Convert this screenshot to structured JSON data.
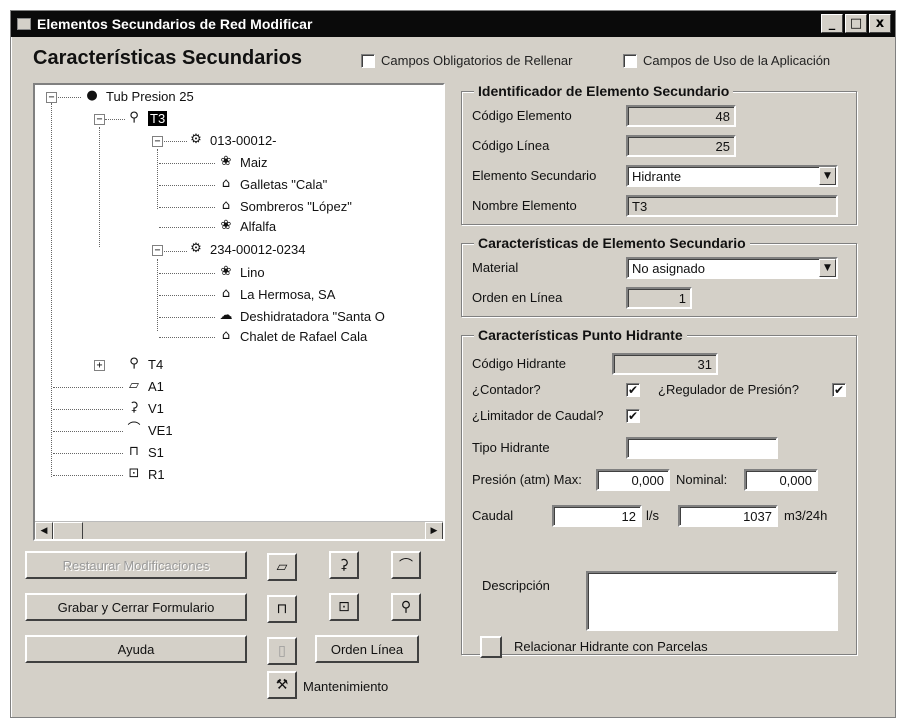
{
  "window": {
    "title": "Elementos Secundarios de Red Modificar",
    "controls": [
      "_",
      "□",
      "x"
    ]
  },
  "header": {
    "title": "Características Secundarios",
    "chk_required": "Campos Obligatorios de Rellenar",
    "chk_app": "Campos de Uso de la Aplicación"
  },
  "tree": {
    "root": "Tub Presion 25",
    "t3": "T3",
    "n1": "013-00012-",
    "n1_children": [
      "Maiz",
      "Galletas \"Cala\"",
      "Sombreros \"López\"",
      "Alfalfa"
    ],
    "n2": "234-00012-0234",
    "n2_children": [
      "Lino",
      "La Hermosa, SA",
      "Deshidratadora \"Santa O",
      "Chalet de Rafael Cala"
    ],
    "others": [
      "T4",
      "A1",
      "V1",
      "VE1",
      "S1",
      "R1"
    ]
  },
  "buttons": {
    "restore": "Restaurar Modificaciones",
    "save_close": "Grabar y Cerrar Formulario",
    "help": "Ayuda",
    "order": "Orden Línea",
    "maintenance": "Mantenimiento"
  },
  "ident": {
    "title": "Identificador de Elemento Secundario",
    "codigo_elemento_label": "Código Elemento",
    "codigo_elemento": "48",
    "codigo_linea_label": "Código Línea",
    "codigo_linea": "25",
    "elemento_label": "Elemento Secundario",
    "elemento": "Hidrante",
    "nombre_label": "Nombre Elemento",
    "nombre": "T3"
  },
  "caract": {
    "title": "Características de Elemento Secundario",
    "material_label": "Material",
    "material": "No asignado",
    "orden_label": "Orden en Línea",
    "orden": "1"
  },
  "hidrante": {
    "title": "Características Punto Hidrante",
    "codigo_label": "Código Hidrante",
    "codigo": "31",
    "contador_label": "¿Contador?",
    "contador": "✔",
    "regulador_label": "¿Regulador de Presión?",
    "regulador": "✔",
    "limitador_label": "¿Limitador de Caudal?",
    "limitador": "✔",
    "tipo_label": "Tipo Hidrante",
    "tipo": "",
    "presion_label": "Presión (atm) Max:",
    "presion_max": "0,000",
    "nominal_label": "Nominal:",
    "presion_nominal": "0,000",
    "caudal_label": "Caudal",
    "caudal_ls": "12",
    "unit_ls": "l/s",
    "caudal_m3": "1037",
    "unit_m3": "m3/24h",
    "descripcion_label": "Descripción",
    "descripcion": "",
    "relacionar_label": "Relacionar Hidrante con Parcelas"
  }
}
